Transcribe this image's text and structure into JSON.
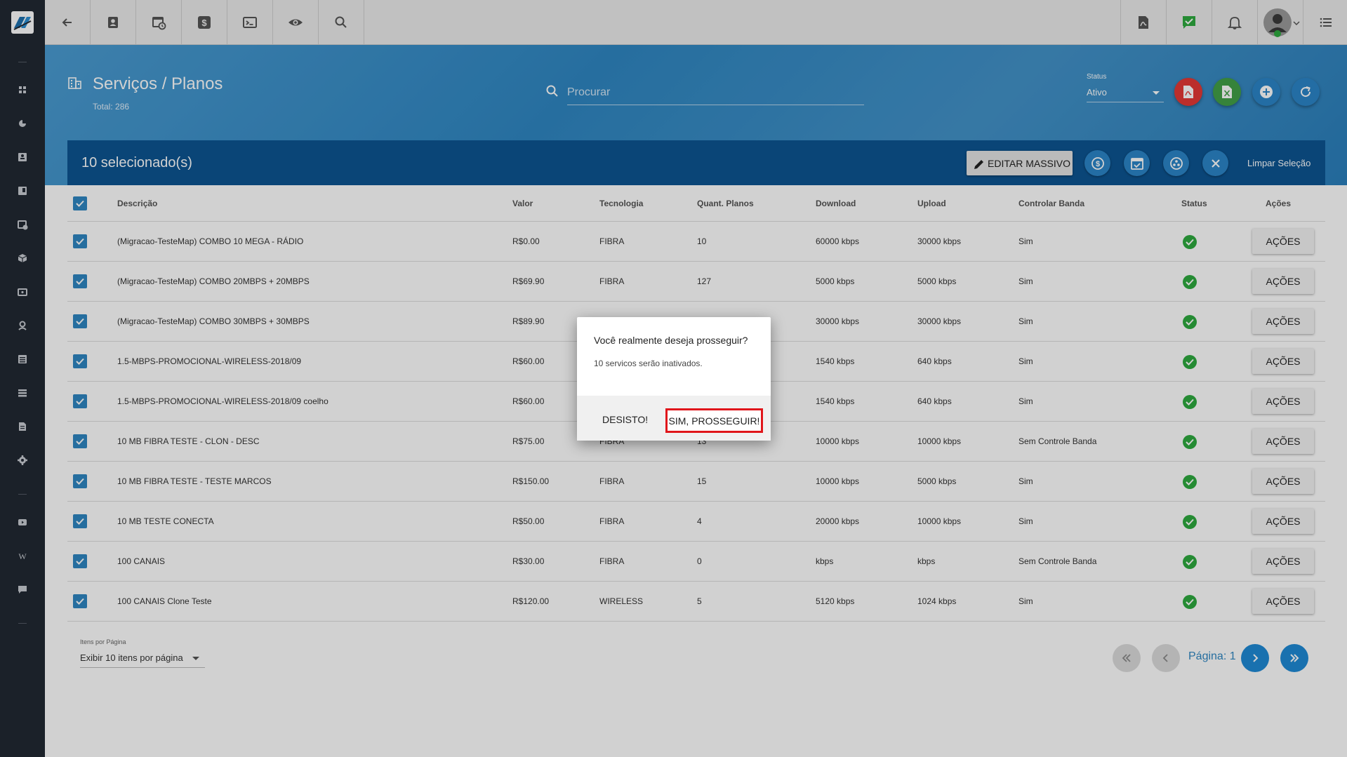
{
  "colors": {
    "brand": "#2f87c3",
    "selection_bar": "#0d5592",
    "sidebar": "#222933",
    "pdf": "#e53935",
    "excel": "#43a047",
    "status_ok": "#2eaa3f",
    "highlight": "#e0161b"
  },
  "header": {
    "title": "Serviços / Planos",
    "total": "Total: 286",
    "search_placeholder": "Procurar",
    "status_label": "Status",
    "status_value": "Ativo"
  },
  "selection": {
    "count": "10 selecionado(s)",
    "edit_massivo": "EDITAR MASSIVO",
    "limpar": "Limpar Seleção"
  },
  "table": {
    "columns": [
      "Descrição",
      "Valor",
      "Tecnologia",
      "Quant. Planos",
      "Download",
      "Upload",
      "Controlar Banda",
      "Status",
      "Ações"
    ],
    "action_label": "AÇÕES",
    "rows": [
      {
        "descricao": "(Migracao-TesteMap) COMBO 10 MEGA - RÁDIO",
        "valor": "R$0.00",
        "tecnologia": "FIBRA",
        "quant": "10",
        "download": "60000 kbps",
        "upload": "30000 kbps",
        "banda": "Sim"
      },
      {
        "descricao": "(Migracao-TesteMap) COMBO 20MBPS + 20MBPS",
        "valor": "R$69.90",
        "tecnologia": "FIBRA",
        "quant": "127",
        "download": "5000 kbps",
        "upload": "5000 kbps",
        "banda": "Sim"
      },
      {
        "descricao": "(Migracao-TesteMap) COMBO 30MBPS + 30MBPS",
        "valor": "R$89.90",
        "tecnologia": "",
        "quant": "",
        "download": "30000 kbps",
        "upload": "30000 kbps",
        "banda": "Sim"
      },
      {
        "descricao": "1.5-MBPS-PROMOCIONAL-WIRELESS-2018/09",
        "valor": "R$60.00",
        "tecnologia": "",
        "quant": "",
        "download": "1540 kbps",
        "upload": "640 kbps",
        "banda": "Sim"
      },
      {
        "descricao": "1.5-MBPS-PROMOCIONAL-WIRELESS-2018/09 coelho",
        "valor": "R$60.00",
        "tecnologia": "",
        "quant": "",
        "download": "1540 kbps",
        "upload": "640 kbps",
        "banda": "Sim"
      },
      {
        "descricao": "10 MB FIBRA TESTE - CLON - DESC",
        "valor": "R$75.00",
        "tecnologia": "FIBRA",
        "quant": "13",
        "download": "10000 kbps",
        "upload": "10000 kbps",
        "banda": "Sem Controle Banda"
      },
      {
        "descricao": "10 MB FIBRA TESTE - TESTE MARCOS",
        "valor": "R$150.00",
        "tecnologia": "FIBRA",
        "quant": "15",
        "download": "10000 kbps",
        "upload": "5000 kbps",
        "banda": "Sim"
      },
      {
        "descricao": "10 MB TESTE CONECTA",
        "valor": "R$50.00",
        "tecnologia": "FIBRA",
        "quant": "4",
        "download": "20000 kbps",
        "upload": "10000 kbps",
        "banda": "Sim"
      },
      {
        "descricao": "100 CANAIS",
        "valor": "R$30.00",
        "tecnologia": "FIBRA",
        "quant": "0",
        "download": "kbps",
        "upload": "kbps",
        "banda": "Sem Controle Banda"
      },
      {
        "descricao": "100 CANAIS Clone Teste",
        "valor": "R$120.00",
        "tecnologia": "WIRELESS",
        "quant": "5",
        "download": "5120 kbps",
        "upload": "1024 kbps",
        "banda": "Sim"
      }
    ]
  },
  "footer": {
    "items_label": "Itens por Página",
    "items_value": "Exibir 10 itens por página",
    "page_label": "Página: 1"
  },
  "dialog": {
    "title": "Você realmente deseja prosseguir?",
    "message": "10 servicos serão inativados.",
    "cancel": "DESISTO!",
    "confirm": "SIM, PROSSEGUIR!"
  },
  "icons": {
    "sidebar": [
      "dashboard-icon",
      "pie-chart-icon",
      "contact-card-icon",
      "book-icon",
      "calendar-clock-icon",
      "package-icon",
      "money-icon",
      "user-location-icon",
      "list-icon",
      "stack-icon",
      "document-icon",
      "settings-icon",
      "video-icon",
      "wiki-icon",
      "chat-icon"
    ],
    "topbar": [
      "back-arrow-icon",
      "contact-icon",
      "calendar-clock-icon",
      "dollar-icon",
      "terminal-icon",
      "eye-icon",
      "search-icon"
    ],
    "topbar_right": [
      "pdf-document-icon",
      "check-message-icon",
      "bell-icon",
      "avatar",
      "menu-icon"
    ]
  }
}
